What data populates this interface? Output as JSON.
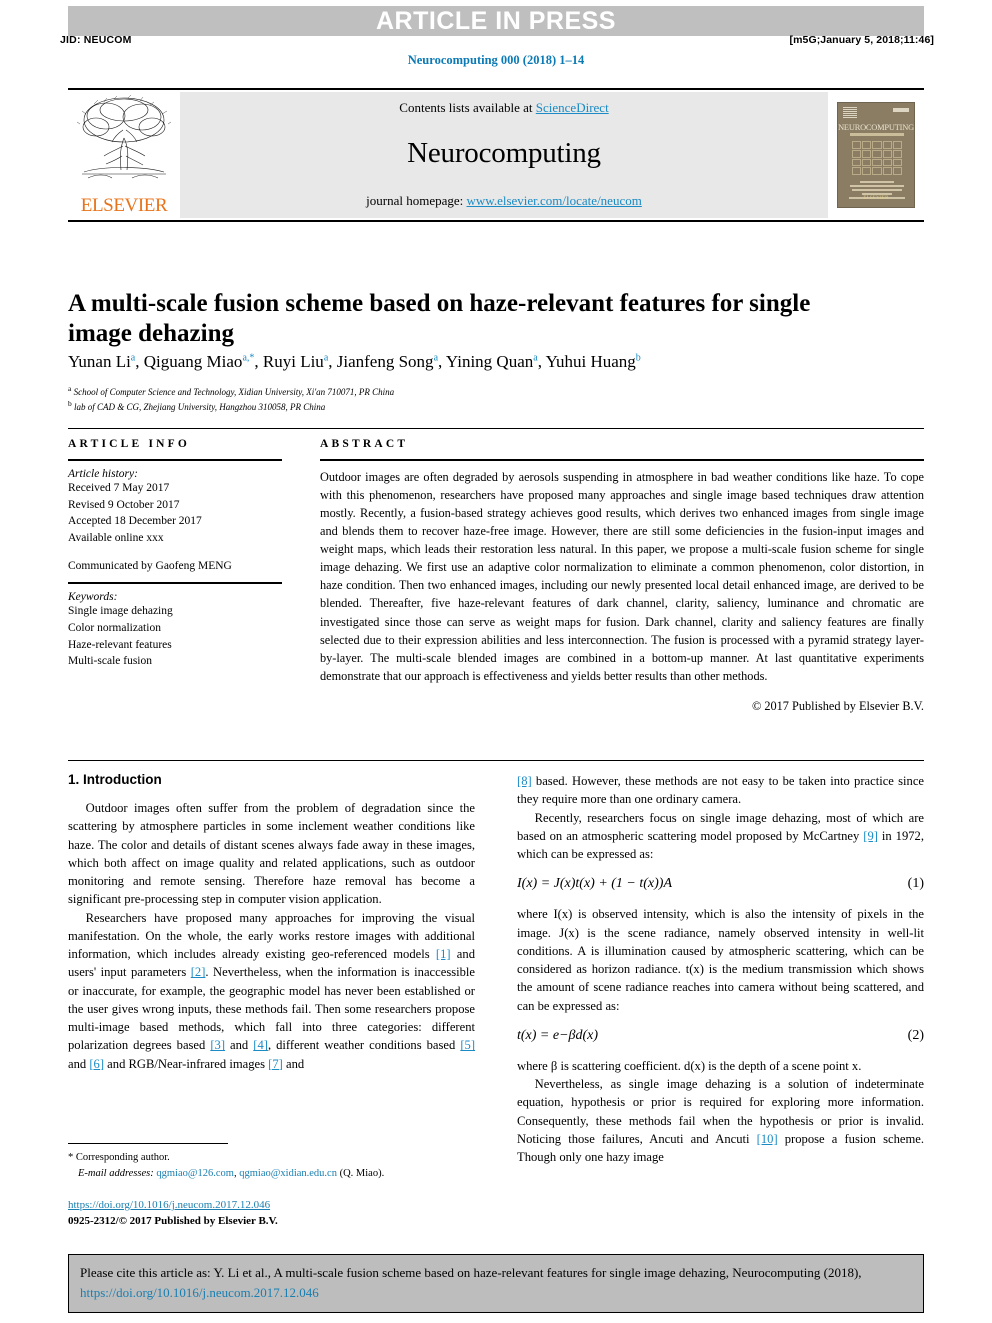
{
  "runninghead": {
    "press_banner": "ARTICLE IN PRESS",
    "jid": "JID: NEUCOM",
    "stamp": "[m5G;January 5, 2018;11:46]",
    "journal_ref": "Neurocomputing 000 (2018) 1–14"
  },
  "masthead": {
    "contents_prefix": "Contents lists available at ",
    "sciencedirect": "ScienceDirect",
    "journal_name": "Neurocomputing",
    "homepage_prefix": "journal homepage: ",
    "homepage_url": "www.elsevier.com/locate/neucom",
    "publisher": "ELSEVIER",
    "cover": {
      "brand": "NEUROCOMPUTING",
      "footer": "ELSEVIER"
    }
  },
  "article": {
    "title": "A multi-scale fusion scheme based on haze-relevant features for single image dehazing",
    "authors_html": "Yunan Li<sup>a</sup>, Qiguang Miao<sup>a,*</sup>, Ruyi Liu<sup>a</sup>, Jianfeng Song<sup>a</sup>, Yining Quan<sup>a</sup>, Yuhui Huang<sup>b</sup>",
    "affiliations": [
      "School of Computer Science and Technology, Xidian University, Xi'an 710071, PR China",
      "lab of CAD & CG, Zhejiang University, Hangzhou 310058, PR China"
    ],
    "affiliation_marks": [
      "a",
      "b"
    ]
  },
  "info": {
    "heading": "ARTICLE INFO",
    "history_title": "Article history:",
    "history": [
      "Received 7 May 2017",
      "Revised 9 October 2017",
      "Accepted 18 December 2017",
      "Available online xxx"
    ],
    "communicated": "Communicated by Gaofeng MENG",
    "keywords_title": "Keywords:",
    "keywords": [
      "Single image dehazing",
      "Color normalization",
      "Haze-relevant features",
      "Multi-scale fusion"
    ]
  },
  "abstract": {
    "heading": "ABSTRACT",
    "body": "Outdoor images are often degraded by aerosols suspending in atmosphere in bad weather conditions like haze. To cope with this phenomenon, researchers have proposed many approaches and single image based techniques draw attention mostly. Recently, a fusion-based strategy achieves good results, which derives two enhanced images from single image and blends them to recover haze-free image. However, there are still some deficiencies in the fusion-input images and weight maps, which leads their restoration less natural. In this paper, we propose a multi-scale fusion scheme for single image dehazing. We first use an adaptive color normalization to eliminate a common phenomenon, color distortion, in haze condition. Then two enhanced images, including our newly presented local detail enhanced image, are derived to be blended. Thereafter, five haze-relevant features of dark channel, clarity, saliency, luminance and chromatic are investigated since those can serve as weight maps for fusion. Dark channel, clarity and saliency features are finally selected due to their expression abilities and less interconnection. The fusion is processed with a pyramid strategy layer-by-layer. The multi-scale blended images are combined in a bottom-up manner. At last quantitative experiments demonstrate that our approach is effectiveness and yields better results than other methods.",
    "copyright": "© 2017 Published by Elsevier B.V."
  },
  "body": {
    "section1_heading": "1. Introduction",
    "left_paragraphs": [
      "Outdoor images often suffer from the problem of degradation since the scattering by atmosphere particles in some inclement weather conditions like haze. The color and details of distant scenes always fade away in these images, which both affect on image quality and related applications, such as outdoor monitoring and remote sensing. Therefore haze removal has become a significant pre-processing step in computer vision application."
    ],
    "left_p2_parts": {
      "a": "Researchers have proposed many approaches for improving the visual manifestation. On the whole, the early works restore images with additional information, which includes already existing geo-referenced models ",
      "r1": "[1]",
      "b": " and users' input parameters ",
      "r2": "[2]",
      "c": ". Nevertheless, when the information is inaccessible or inaccurate, for example, the geographic model has never been established or the user gives wrong inputs, these methods fail. Then some researchers propose multi-image based methods, which fall into three categories: different polarization degrees based ",
      "r3": "[3]",
      "d": " and ",
      "r4": "[4]",
      "e": ", different weather conditions based ",
      "r5": "[5]",
      "f": " and ",
      "r6": "[6]",
      "g": " and RGB/Near-infrared images ",
      "r7": "[7]",
      "h": " and"
    },
    "right_p1_parts": {
      "r8": "[8]",
      "a": " based. However, these methods are not easy to be taken into practice since they require more than one ordinary camera."
    },
    "right_p2_parts": {
      "a": "Recently, researchers focus on single image dehazing, most of which are based on an atmospheric scattering model proposed by McCartney ",
      "r9": "[9]",
      "b": " in 1972, which can be expressed as:"
    },
    "equation1": {
      "lhs": "I(x) = J(x)t(x) + (1 − t(x))A",
      "number": "(1)"
    },
    "right_p3": "where I(x) is observed intensity, which is also the intensity of pixels in the image. J(x) is the scene radiance, namely observed intensity in well-lit conditions. A is illumination caused by atmospheric scattering, which can be considered as horizon radiance. t(x) is the medium transmission which shows the amount of scene radiance reaches into camera without being scattered, and can be expressed as:",
    "equation2": {
      "lhs": "t(x) = e−βd(x)",
      "number": "(2)"
    },
    "right_p4": "where β is scattering coefficient. d(x) is the depth of a scene point x.",
    "right_p5_parts": {
      "a": "Nevertheless, as single image dehazing is a solution of indeterminate equation, hypothesis or prior is required for exploring more information. Consequently, these methods fail when the hypothesis or prior is invalid. Noticing those failures, Ancuti and Ancuti ",
      "r10": "[10]",
      "b": " propose a fusion scheme. Though only one hazy image"
    }
  },
  "footnote": {
    "corresponding": "Corresponding author.",
    "email_label": "E-mail addresses:",
    "email1": "qgmiao@126.com",
    "email_sep": ", ",
    "email2": "qgmiao@xidian.edu.cn",
    "email_suffix": " (Q. Miao).",
    "doi": "https://doi.org/10.1016/j.neucom.2017.12.046",
    "issn_line": "0925-2312/© 2017 Published by Elsevier B.V."
  },
  "citation_box": {
    "prefix": "Please cite this article as: Y. Li et al., A multi-scale fusion scheme based on haze-relevant features for single image dehazing, Neurocomputing (2018), ",
    "link": "https://doi.org/10.1016/j.neucom.2017.12.046"
  },
  "colors": {
    "link": "#1a8bc4",
    "banner_bg": "#bfbfbf",
    "masthead_bg": "#e8e8e8",
    "elsevier_orange": "#e8731a",
    "cite_box_bg": "#bdbdbd"
  }
}
